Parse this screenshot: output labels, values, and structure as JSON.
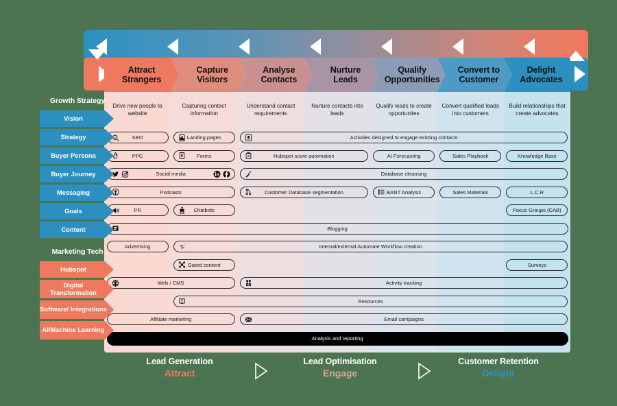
{
  "background_color": "#4d7450",
  "accent": {
    "blue": "#2b90c0",
    "red": "#ee795f",
    "dark": "#000000"
  },
  "topbar": {
    "arrow_icon": "triangle-left-icon",
    "arrow_count": 7,
    "left_cap_icon": "triangle-down-icon",
    "right_cap_icon": "triangle-up-icon",
    "lower_left_icon": "triangle-right-icon",
    "lower_right_icon": "triangle-right-icon"
  },
  "stages": [
    {
      "title": "Attract\nStrangers",
      "line1": "Attract",
      "line2": "Strangers",
      "desc": "Drive new people to website",
      "chev_color": "#ee795f",
      "col_bg": "#f9d9d2"
    },
    {
      "title": "Capture Visitors",
      "line1": "Capture",
      "line2": "Visitors",
      "desc": "Capturing contact information",
      "chev_color": "#e08c7d",
      "col_bg": "#f6dcd8"
    },
    {
      "title": "Analyse Contacts",
      "line1": "Analyse",
      "line2": "Contacts",
      "desc": "Understand contact requirements",
      "chev_color": "#c9908f",
      "col_bg": "#eddedf"
    },
    {
      "title": "Nurture Leads",
      "line1": "Nurture",
      "line2": "Leads",
      "desc": "Nurture contacts into leads",
      "chev_color": "#a894a4",
      "col_bg": "#e3e1e7"
    },
    {
      "title": "Qualify Opportunities",
      "line1": "Qualify",
      "line2": "Opportunities",
      "desc": "Qualify leads to create opportunites",
      "chev_color": "#8c9bb6",
      "col_bg": "#dbe3ec"
    },
    {
      "title": "Convert to Customer",
      "line1": "Convert to",
      "line2": "Customer",
      "desc": "Convert qualified leads into customers",
      "chev_color": "#4d9ac5",
      "col_bg": "#cfe4ee"
    },
    {
      "title": "Delight Advocates",
      "line1": "Delight",
      "line2": "Advocates",
      "desc": "Build relationships that create advocates",
      "chev_color": "#2b90c0",
      "col_bg": "#c5e2ef"
    }
  ],
  "sidebar": {
    "groups": [
      {
        "title": "Growth Strategy",
        "color": "blue",
        "items": [
          {
            "label": "Vision"
          },
          {
            "label": "Strategy"
          },
          {
            "label": "Buyer Persona"
          },
          {
            "label": "Buyer Journey"
          },
          {
            "label": "Messaging"
          },
          {
            "label": "Goals"
          },
          {
            "label": "Content"
          }
        ]
      },
      {
        "title": "Marketing Tech",
        "color": "red",
        "items": [
          {
            "label": "Hubspot"
          },
          {
            "label": "Digital Transformation"
          },
          {
            "label": "Software/ Integrations"
          },
          {
            "label": "AI/Machine Learning"
          }
        ]
      }
    ]
  },
  "pills": [
    {
      "id": "seo",
      "label": "SEO",
      "icon": "search-icon",
      "col_start": 0,
      "col_span": 1,
      "row": 0
    },
    {
      "id": "landing-pages",
      "label": "Landing pages",
      "icon": "chart-doc-icon",
      "col_start": 1,
      "col_span": 1,
      "row": 0
    },
    {
      "id": "activities-engage",
      "label": "Activities designed to engage existing contacts",
      "icon": "contact-card-icon",
      "col_start": 2,
      "col_span": 5,
      "row": 0
    },
    {
      "id": "ppc",
      "label": "PPC",
      "icon": "click-hand-icon",
      "col_start": 0,
      "col_span": 1,
      "row": 1
    },
    {
      "id": "forms",
      "label": "Forms",
      "icon": "form-doc-icon",
      "col_start": 1,
      "col_span": 1,
      "row": 1
    },
    {
      "id": "hubspot-score-automation",
      "label": "Hubspot score automation",
      "icon": "clipboard-check-icon",
      "col_start": 2,
      "col_span": 2,
      "row": 1
    },
    {
      "id": "ai-forecasting",
      "label": "AI Forecasting",
      "icon": "",
      "col_start": 4,
      "col_span": 1,
      "row": 1
    },
    {
      "id": "sales-playbook",
      "label": "Sales Playbook",
      "icon": "",
      "col_start": 5,
      "col_span": 1,
      "row": 1
    },
    {
      "id": "knowledge-base",
      "label": "Knowledge Base",
      "icon": "",
      "col_start": 6,
      "col_span": 1,
      "row": 1
    },
    {
      "id": "social-media",
      "label": "Social media",
      "icon": "twitter-icon",
      "icon2": "instagram-icon",
      "icon_right_1": "linkedin-icon",
      "icon_right_2": "facebook-icon",
      "col_start": 0,
      "col_span": 2,
      "row": 2
    },
    {
      "id": "database-cleansing",
      "label": "Database cleansing",
      "icon": "broom-icon",
      "col_start": 2,
      "col_span": 5,
      "row": 2
    },
    {
      "id": "podcasts",
      "label": "Podcasts",
      "icon": "podcast-icon",
      "col_start": 0,
      "col_span": 2,
      "row": 3
    },
    {
      "id": "customer-database-segmentation",
      "label": "Customer Database segmentation",
      "icon": "segment-icon",
      "col_start": 2,
      "col_span": 2,
      "row": 3
    },
    {
      "id": "bant-analysis",
      "label": "BANT Analysis",
      "icon": "list-icon",
      "col_start": 4,
      "col_span": 1,
      "row": 3
    },
    {
      "id": "sales-materials",
      "label": "Sales Materials",
      "icon": "",
      "col_start": 5,
      "col_span": 1,
      "row": 3
    },
    {
      "id": "lcr",
      "label": "L.C.R",
      "icon": "",
      "col_start": 6,
      "col_span": 1,
      "row": 3
    },
    {
      "id": "pr",
      "label": "PR",
      "icon": "megaphone-icon",
      "col_start": 0,
      "col_span": 1,
      "row": 4
    },
    {
      "id": "chatbots",
      "label": "Chatbots",
      "icon": "robot-icon",
      "col_start": 1,
      "col_span": 1,
      "row": 4
    },
    {
      "id": "focus-groups",
      "label": "Focus Groups (CAB)",
      "icon": "",
      "col_start": 6,
      "col_span": 1,
      "row": 4
    },
    {
      "id": "blogging",
      "label": "Blogging",
      "icon": "blog-icon",
      "col_start": 0,
      "col_span": 7,
      "row": 5
    },
    {
      "id": "advertising",
      "label": "Advertising",
      "icon": "",
      "col_start": 0,
      "col_span": 1,
      "row": 6
    },
    {
      "id": "workflow-creation",
      "label": "Internal/external Automate Workflow creation",
      "icon": "workflow-icon",
      "col_start": 1,
      "col_span": 6,
      "row": 6
    },
    {
      "id": "gated-content",
      "label": "Gated content",
      "icon": "hub-icon",
      "col_start": 1,
      "col_span": 1,
      "row": 7
    },
    {
      "id": "surveys",
      "label": "Surveys",
      "icon": "",
      "col_start": 6,
      "col_span": 1,
      "row": 7
    },
    {
      "id": "web-cms",
      "label": "Web / CMS",
      "icon": "globe-icon",
      "col_start": 0,
      "col_span": 2,
      "row": 8
    },
    {
      "id": "activity-tracking",
      "label": "Activity tracking",
      "icon": "people-icon",
      "col_start": 2,
      "col_span": 5,
      "row": 8
    },
    {
      "id": "resources",
      "label": "Resources",
      "icon": "book-icon",
      "col_start": 1,
      "col_span": 6,
      "row": 9
    },
    {
      "id": "affiliate-marketing",
      "label": "Affiliate marketing",
      "icon": "",
      "col_start": 0,
      "col_span": 2,
      "row": 10
    },
    {
      "id": "email-campaigns",
      "label": "Email campaigns",
      "icon": "envelope-icon",
      "col_start": 2,
      "col_span": 5,
      "row": 10
    },
    {
      "id": "analysis-reporting",
      "label": "Analysis and reporting",
      "icon": "",
      "col_start": 0,
      "col_span": 7,
      "row": 11,
      "dark": true
    }
  ],
  "footer": {
    "sections": [
      {
        "title": "Lead Generation",
        "subtitle": "Attract",
        "subtitle_color": "#ee795f"
      },
      {
        "title": "Lead Optimisation",
        "subtitle": "Engage",
        "subtitle_color": "#d9a198"
      },
      {
        "title": "Customer Retention",
        "subtitle": "Delight",
        "subtitle_color": "#2b90c0"
      }
    ],
    "arrow_icon": "triangle-right-outline-icon"
  }
}
